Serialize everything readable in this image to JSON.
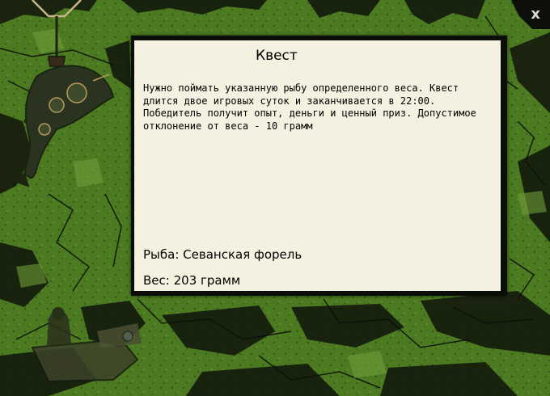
{
  "dialog": {
    "title": "Квест",
    "description": "Нужно поймать указанную рыбу определенного веса. Квест длится двое игровых суток и заканчивается в 22:00. Победитель получит опыт, деньги и ценный приз. Допустимое отклонение от веса - 10 грамм",
    "fish_label": "Рыба:",
    "fish_value": "Севанская форель",
    "weight_label": "Вес:",
    "weight_value": "203 грамм"
  },
  "close": {
    "label": "x",
    "icon": "close-icon"
  },
  "colors": {
    "background_green": "#4e7a22",
    "crack_dark": "#0d100a",
    "dialog_bg": "#f4f1e1",
    "dialog_border": "#0a0d08"
  }
}
